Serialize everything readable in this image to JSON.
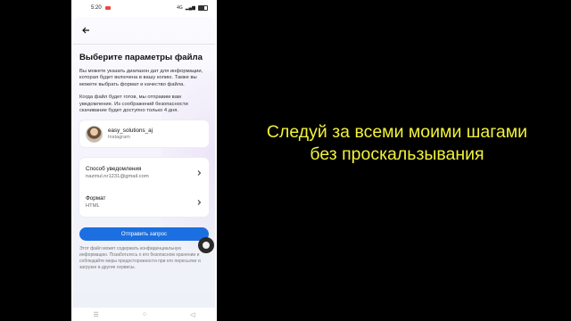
{
  "status_bar": {
    "time": "5:20",
    "network": "4G",
    "battery": ""
  },
  "sheet": {
    "title": "Выберите параметры файла",
    "description_1": "Вы можете указать диапазон дат для информации, которая будет включена в вашу копию. Также вы можете выбрать формат и качество файла.",
    "description_2": "Когда файл будет готов, мы отправим вам уведомление. Из соображений безопасности скачивание будет доступно только 4 дня.",
    "account": {
      "username": "easy_solutions_aj",
      "platform": "Instagram"
    },
    "settings": [
      {
        "label": "Способ уведомления",
        "value": "nazmul.nr1231@gmail.com"
      },
      {
        "label": "Формат",
        "value": "HTML"
      }
    ],
    "submit_label": "Отправить запрос",
    "footer": "Этот файл может содержать конфиденциальную информацию. Позаботьтесь о его безопасном хранении и соблюдайте меры предосторожности при его пересылке и загрузке в другие сервисы."
  },
  "nav": {
    "recent": "☰",
    "home": "○",
    "back": "◁"
  },
  "caption": {
    "line_1": "Следуй за всеми моими шагами",
    "line_2": "без проскальзывания"
  },
  "colors": {
    "accent": "#1b6fe0",
    "caption": "#f2f23a",
    "background": "#000000"
  }
}
